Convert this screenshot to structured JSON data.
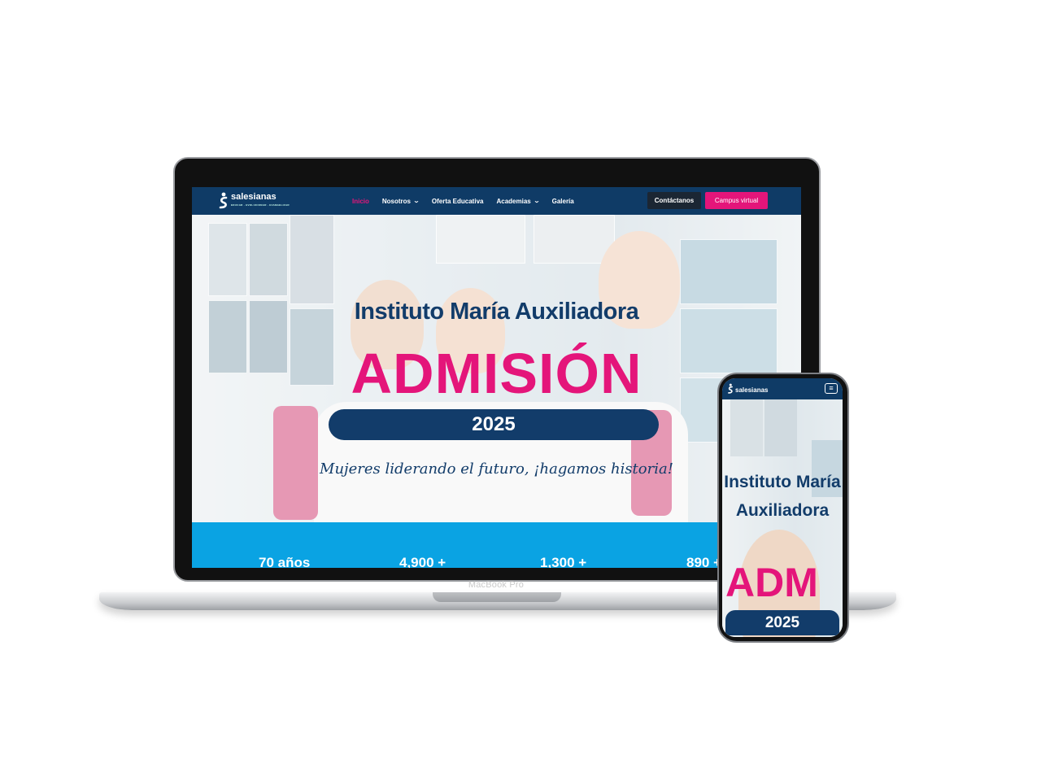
{
  "site": {
    "logo_text": "salesianas",
    "logo_subtext": "EDUCAR · EVOLUCIONAR · EVANGELIZAR",
    "nav": [
      {
        "label": "Inicio",
        "active": true
      },
      {
        "label": "Nosotros",
        "dropdown": true
      },
      {
        "label": "Oferta Educativa"
      },
      {
        "label": "Academias",
        "dropdown": true
      },
      {
        "label": "Galería"
      }
    ],
    "contact_button": "Contáctanos",
    "campus_button": "Campus virtual",
    "hero": {
      "title": "Instituto María Auxiliadora",
      "headline": "ADMISIÓN",
      "year": "2025",
      "slogan": "Mujeres liderando el futuro, ¡hagamos historia!"
    },
    "stats": [
      "70 años",
      "4,900 +",
      "1,300 +",
      "890 +"
    ]
  },
  "laptop": {
    "model_label": "MacBook Pro"
  },
  "phone": {
    "logo_text": "salesianas",
    "menu_icon": "hamburger-icon",
    "title": "Instituto María Auxiliadora",
    "headline": "ADM",
    "year": "2025"
  },
  "colors": {
    "navy": "#0f3b66",
    "pink": "#e4157a",
    "sky": "#0aa3e3"
  }
}
